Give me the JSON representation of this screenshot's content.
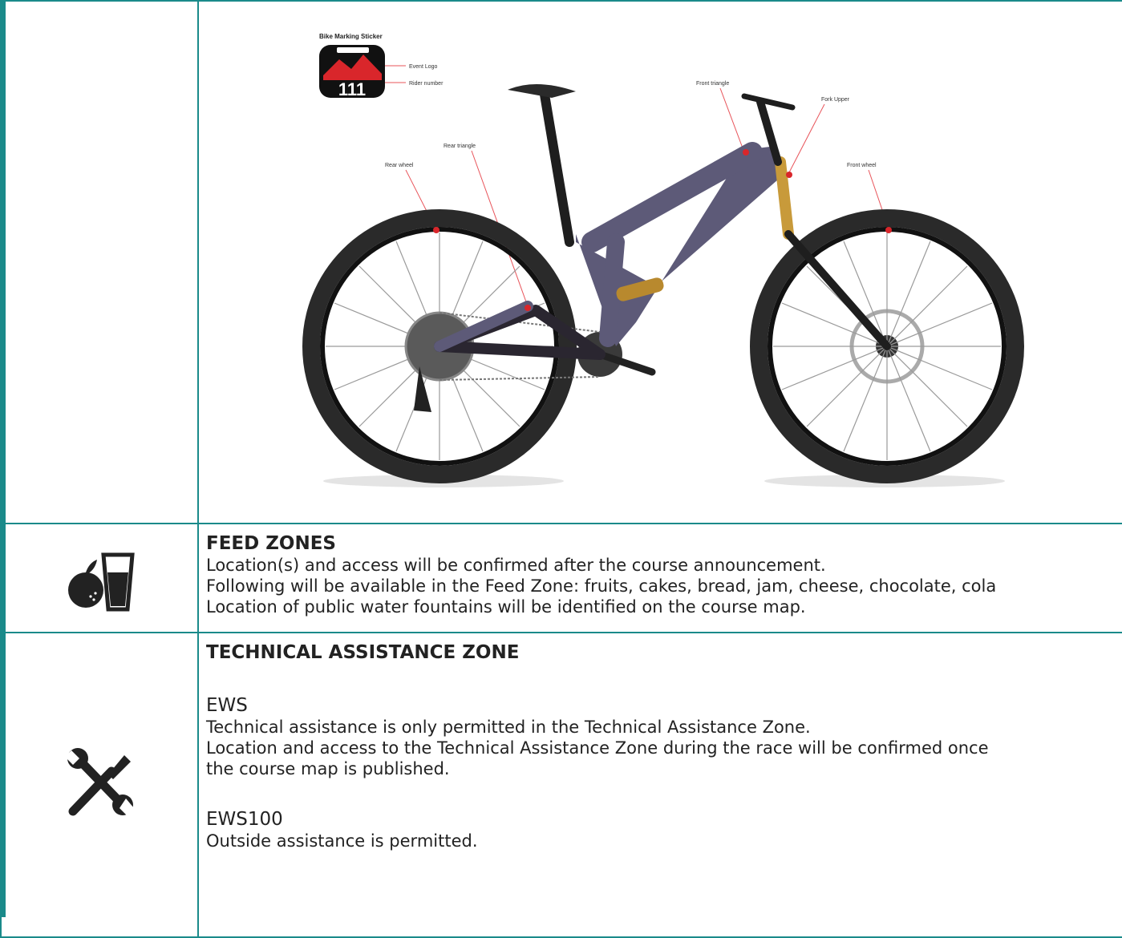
{
  "bike_diagram": {
    "sticker_title": "Bike Marking Sticker",
    "sticker_number": "111",
    "labels": {
      "event_logo": "Event Logo",
      "rider_number": "Rider number",
      "front_triangle": "Front triangle",
      "fork_upper": "Fork Upper",
      "rear_triangle": "Rear triangle",
      "rear_wheel": "Rear wheel",
      "front_wheel": "Front wheel"
    },
    "colors": {
      "frame": "#5d5a78",
      "leader_line": "#e8545a",
      "fork": "#c89a3a"
    }
  },
  "feed_zones": {
    "icon": "apple-and-glass-icon",
    "heading": "FEED ZONES",
    "lines": [
      "Location(s) and access will be confirmed after the course announcement.",
      "Following will be available in the Feed Zone: fruits, cakes, bread, jam, cheese, chocolate, cola",
      "Location of public water fountains will be identified on the course map."
    ]
  },
  "technical_assistance": {
    "icon": "wrench-screwdriver-icon",
    "heading": "TECHNICAL ASSISTANCE ZONE",
    "ews": {
      "title": "EWS",
      "lines": [
        "Technical assistance is only permitted in the Technical Assistance Zone.",
        "Location and access to the Technical Assistance Zone during the race will be confirmed once",
        "the course map is published."
      ]
    },
    "ews100": {
      "title": "EWS100",
      "lines": [
        "Outside assistance is permitted."
      ]
    }
  },
  "accent_color": "#1a8a8a"
}
